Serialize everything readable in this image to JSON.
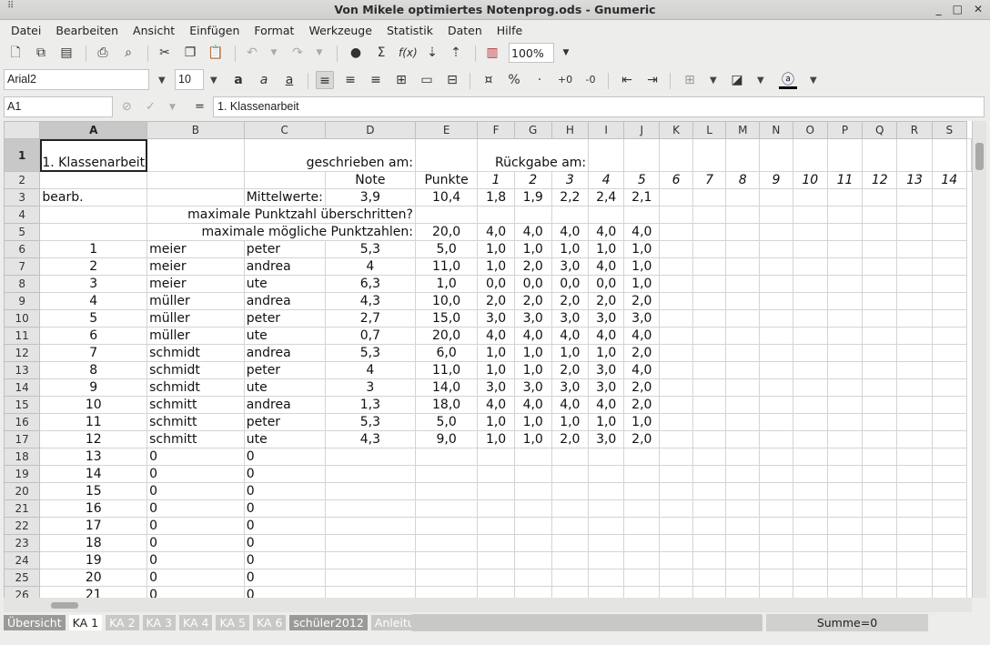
{
  "window": {
    "title": "Von Mikele optimiertes Notenprog.ods - Gnumeric",
    "grip_icon": "grip-icon",
    "controls": [
      "_",
      "□",
      "✕"
    ]
  },
  "menu": [
    "Datei",
    "Bearbeiten",
    "Ansicht",
    "Einfügen",
    "Format",
    "Werkzeuge",
    "Statistik",
    "Daten",
    "Hilfe"
  ],
  "toolbar": {
    "zoom": "100%"
  },
  "format": {
    "font": "Arial2",
    "size": "10"
  },
  "formula": {
    "cell_ref": "A1",
    "equals": "=",
    "content": "1. Klassenarbeit"
  },
  "sheet": {
    "columns": [
      "A",
      "B",
      "C",
      "D",
      "E",
      "F",
      "G",
      "H",
      "I",
      "J",
      "K",
      "L",
      "M",
      "N",
      "O",
      "P",
      "Q",
      "R",
      "S"
    ],
    "row1": {
      "a": "1. Klassenarbeit",
      "cd": "geschrieben am:",
      "fh": "Rückgabe am:"
    },
    "row2": {
      "d": "Note",
      "e": "Punkte",
      "nums": [
        "1",
        "2",
        "3",
        "4",
        "5",
        "6",
        "7",
        "8",
        "9",
        "10",
        "11",
        "12",
        "13",
        "14"
      ]
    },
    "row3": {
      "a": "bearb.",
      "c": "Mittelwerte:",
      "d": "3,9",
      "e": "10,4",
      "vals": [
        "1,8",
        "1,9",
        "2,2",
        "2,4",
        "2,1"
      ]
    },
    "row4": {
      "label": "maximale Punktzahl überschritten?"
    },
    "row5": {
      "label": "maximale mögliche Punktzahlen:",
      "e": "20,0",
      "vals": [
        "4,0",
        "4,0",
        "4,0",
        "4,0",
        "4,0"
      ]
    },
    "students": [
      {
        "n": "1",
        "name": "meier",
        "first": "peter",
        "note": "5,3",
        "pkt": "5,0",
        "v": [
          "1,0",
          "1,0",
          "1,0",
          "1,0",
          "1,0"
        ]
      },
      {
        "n": "2",
        "name": "meier",
        "first": "andrea",
        "note": "4",
        "pkt": "11,0",
        "v": [
          "1,0",
          "2,0",
          "3,0",
          "4,0",
          "1,0"
        ]
      },
      {
        "n": "3",
        "name": "meier",
        "first": "ute",
        "note": "6,3",
        "pkt": "1,0",
        "v": [
          "0,0",
          "0,0",
          "0,0",
          "0,0",
          "1,0"
        ]
      },
      {
        "n": "4",
        "name": "müller",
        "first": "andrea",
        "note": "4,3",
        "pkt": "10,0",
        "v": [
          "2,0",
          "2,0",
          "2,0",
          "2,0",
          "2,0"
        ]
      },
      {
        "n": "5",
        "name": "müller",
        "first": "peter",
        "note": "2,7",
        "pkt": "15,0",
        "v": [
          "3,0",
          "3,0",
          "3,0",
          "3,0",
          "3,0"
        ]
      },
      {
        "n": "6",
        "name": "müller",
        "first": "ute",
        "note": "0,7",
        "pkt": "20,0",
        "v": [
          "4,0",
          "4,0",
          "4,0",
          "4,0",
          "4,0"
        ]
      },
      {
        "n": "7",
        "name": "schmidt",
        "first": "andrea",
        "note": "5,3",
        "pkt": "6,0",
        "v": [
          "1,0",
          "1,0",
          "1,0",
          "1,0",
          "2,0"
        ]
      },
      {
        "n": "8",
        "name": "schmidt",
        "first": "peter",
        "note": "4",
        "pkt": "11,0",
        "v": [
          "1,0",
          "1,0",
          "2,0",
          "3,0",
          "4,0"
        ]
      },
      {
        "n": "9",
        "name": "schmidt",
        "first": "ute",
        "note": "3",
        "pkt": "14,0",
        "v": [
          "3,0",
          "3,0",
          "3,0",
          "3,0",
          "2,0"
        ]
      },
      {
        "n": "10",
        "name": "schmitt",
        "first": "andrea",
        "note": "1,3",
        "pkt": "18,0",
        "v": [
          "4,0",
          "4,0",
          "4,0",
          "4,0",
          "2,0"
        ]
      },
      {
        "n": "11",
        "name": "schmitt",
        "first": "peter",
        "note": "5,3",
        "pkt": "5,0",
        "v": [
          "1,0",
          "1,0",
          "1,0",
          "1,0",
          "1,0"
        ]
      },
      {
        "n": "12",
        "name": "schmitt",
        "first": "ute",
        "note": "4,3",
        "pkt": "9,0",
        "v": [
          "1,0",
          "1,0",
          "2,0",
          "3,0",
          "2,0"
        ]
      }
    ],
    "empty_rows": [
      {
        "n": "13",
        "b": "0",
        "c": "0"
      },
      {
        "n": "14",
        "b": "0",
        "c": "0"
      },
      {
        "n": "15",
        "b": "0",
        "c": "0"
      },
      {
        "n": "16",
        "b": "0",
        "c": "0"
      },
      {
        "n": "17",
        "b": "0",
        "c": "0"
      },
      {
        "n": "18",
        "b": "0",
        "c": "0"
      },
      {
        "n": "19",
        "b": "0",
        "c": "0"
      },
      {
        "n": "20",
        "b": "0",
        "c": "0"
      },
      {
        "n": "21",
        "b": "0",
        "c": "0"
      }
    ]
  },
  "tabs": [
    "Übersicht",
    "KA 1",
    "KA 2",
    "KA 3",
    "KA 4",
    "KA 5",
    "KA 6",
    "schüler2012",
    "Anleitung"
  ],
  "active_tab": "KA 1",
  "status": {
    "sum": "Summe=0"
  }
}
